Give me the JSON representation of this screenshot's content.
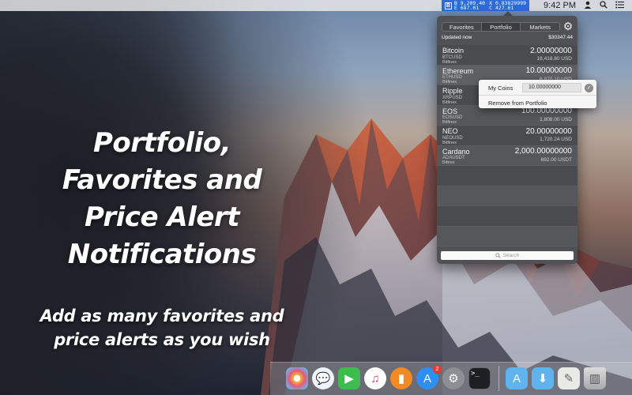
{
  "marketing": {
    "headline_lines": [
      "Portfolio,",
      "Favorites and",
      "Price Alert",
      "Notifications"
    ],
    "subline_lines": [
      "Add as many favorites and",
      "price alerts as you wish"
    ]
  },
  "menubar": {
    "ticker": {
      "logo": "B",
      "line1_left": "B 9,209.40",
      "line1_right": "X 0.83829999",
      "line2_left": "E 687.01",
      "line2_right": "C 427.61"
    },
    "time": "9:42 PM",
    "icons": [
      "user-icon",
      "search-icon",
      "list-icon"
    ]
  },
  "popover": {
    "tabs": [
      {
        "label": "Favorites",
        "active": false
      },
      {
        "label": "Portfolio",
        "active": true
      },
      {
        "label": "Markets",
        "active": false
      }
    ],
    "updated_label": "Updated now",
    "total": "$30347.44",
    "coins": [
      {
        "name": "Bitcoin",
        "pair": "BTCUSD",
        "exchange": "Bitfinex",
        "amount": "2.00000000",
        "value": "18,418.80 USD"
      },
      {
        "name": "Ethereum",
        "pair": "ETHUSD",
        "exchange": "Bitfinex",
        "amount": "10.00000000",
        "value": "6,870.10 USD"
      },
      {
        "name": "Ripple",
        "pair": "XRPUSD",
        "exchange": "Bitfinex",
        "amount": "",
        "value": ""
      },
      {
        "name": "EOS",
        "pair": "EOSUSD",
        "exchange": "Bitfinex",
        "amount": "100.00000000",
        "value": "1,808.00 USD"
      },
      {
        "name": "NEO",
        "pair": "NEOUSD",
        "exchange": "Bitfinex",
        "amount": "20.00000000",
        "value": "1,720.24 USD"
      },
      {
        "name": "Cardano",
        "pair": "ADAUSDT",
        "exchange": "Bittrex",
        "amount": "2,000.00000000",
        "value": "692.00 USDT"
      }
    ],
    "search_placeholder": "Search"
  },
  "context_menu": {
    "my_coins_label": "My Coins",
    "my_coins_value": "10.00000000",
    "remove_label": "Remove from Portfolio"
  },
  "dock": {
    "app_store_badge": "2",
    "apps": [
      "photos-icon",
      "messages-icon",
      "facetime-icon",
      "itunes-icon",
      "ibooks-icon",
      "app-store-icon",
      "system-preferences-icon",
      "terminal-icon",
      "applications-folder-icon",
      "downloads-folder-icon",
      "preview-icon",
      "trash-icon"
    ]
  }
}
